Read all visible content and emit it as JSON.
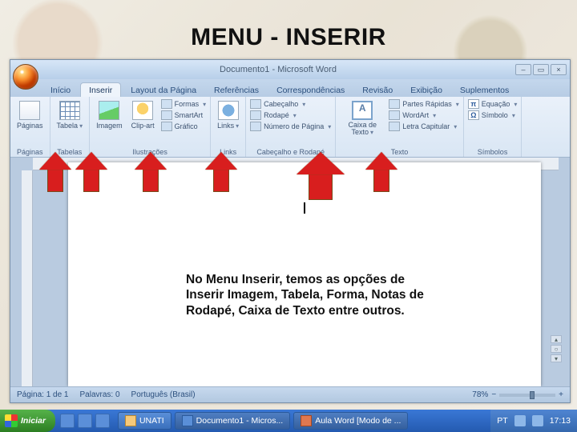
{
  "slide": {
    "title": "MENU - INSERIR",
    "body_text": "No Menu Inserir, temos as opções de Inserir Imagem, Tabela, Forma, Notas de Rodapé, Caixa de Texto entre outros."
  },
  "word": {
    "title": "Documento1 - Microsoft Word",
    "tabs": {
      "inicio": "Início",
      "inserir": "Inserir",
      "layout": "Layout da Página",
      "referencias": "Referências",
      "correspondencias": "Correspondências",
      "revisao": "Revisão",
      "exibicao": "Exibição",
      "suplementos": "Suplementos"
    },
    "ribbon": {
      "paginas": {
        "btn": "Páginas",
        "group": "Páginas"
      },
      "tabelas": {
        "btn": "Tabela",
        "group": "Tabelas"
      },
      "ilustracoes": {
        "imagem": "Imagem",
        "clipart": "Clip-art",
        "formas": "Formas",
        "smartart": "SmartArt",
        "grafico": "Gráfico",
        "group": "Ilustrações"
      },
      "links": {
        "btn": "Links",
        "group": "Links"
      },
      "cabecalho_rodape": {
        "cabecalho": "Cabeçalho",
        "rodape": "Rodapé",
        "numero": "Número de Página",
        "group": "Cabeçalho e Rodapé"
      },
      "texto": {
        "caixa": "Caixa de Texto",
        "partes": "Partes Rápidas",
        "wordart": "WordArt",
        "capitular": "Letra Capitular",
        "group": "Texto"
      },
      "simbolos": {
        "equacao": "Equação",
        "simbolo": "Símbolo",
        "group": "Símbolos"
      }
    },
    "status": {
      "pagina": "Página: 1 de 1",
      "palavras": "Palavras: 0",
      "idioma": "Português (Brasil)",
      "zoom": "78%"
    }
  },
  "taskbar": {
    "start": "Iniciar",
    "tasks": {
      "unati": "UNATI",
      "word": "Documento1 - Micros...",
      "ppt": "Aula Word [Modo de ..."
    },
    "lang": "PT",
    "clock": "17:13"
  }
}
